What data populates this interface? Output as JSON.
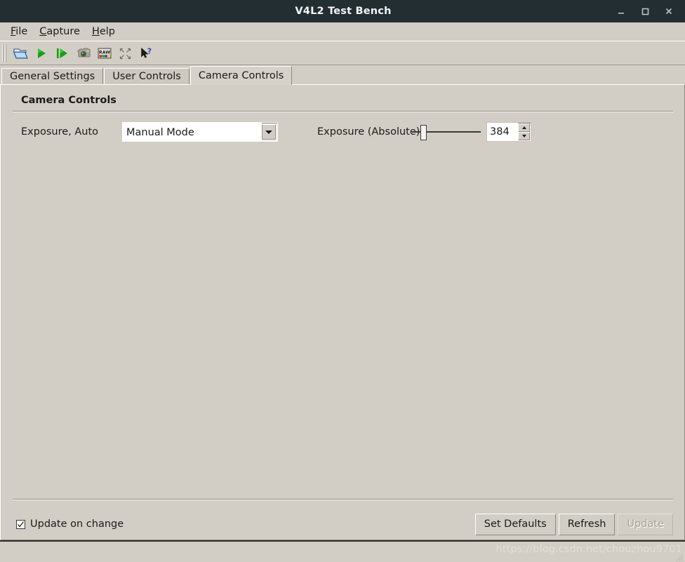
{
  "window": {
    "title": "V4L2 Test Bench",
    "buttons": [
      {
        "name": "minimize-button",
        "icon": "minimize-icon",
        "label": "_"
      },
      {
        "name": "maximize-button",
        "icon": "maximize-icon",
        "label": "□"
      },
      {
        "name": "close-button",
        "icon": "close-icon",
        "label": "×"
      }
    ]
  },
  "menubar": {
    "items": [
      {
        "mnemonic": "F",
        "rest": "ile",
        "name": "menu-file"
      },
      {
        "mnemonic": "C",
        "rest": "apture",
        "name": "menu-capture"
      },
      {
        "mnemonic": "H",
        "rest": "elp",
        "name": "menu-help"
      }
    ]
  },
  "toolbar": {
    "buttons": [
      {
        "icon": "open-folder-icon",
        "name": "toolbar-open"
      },
      {
        "icon": "play-icon",
        "name": "toolbar-play"
      },
      {
        "icon": "play-step-icon",
        "name": "toolbar-step"
      },
      {
        "icon": "camera-icon",
        "name": "toolbar-snapshot"
      },
      {
        "icon": "raw-icon",
        "name": "toolbar-raw"
      },
      {
        "icon": "fullscreen-icon",
        "name": "toolbar-fullscreen"
      },
      {
        "icon": "whats-this-icon",
        "name": "toolbar-whats-this"
      }
    ]
  },
  "tabs": [
    {
      "label": "General Settings",
      "selected": false,
      "name": "tab-general-settings"
    },
    {
      "label": "User Controls",
      "selected": false,
      "name": "tab-user-controls"
    },
    {
      "label": "Camera Controls",
      "selected": true,
      "name": "tab-camera-controls"
    }
  ],
  "panel": {
    "group_title": "Camera Controls",
    "controls": [
      {
        "label": "Exposure, Auto",
        "type": "combobox",
        "value": "Manual Mode",
        "name": "exposure-auto"
      },
      {
        "label": "Exposure (Absolute)",
        "type": "slider-spin",
        "value": "384",
        "slider_percent": 12,
        "name": "exposure-absolute"
      }
    ]
  },
  "bottom": {
    "checkbox": {
      "label": "Update on change",
      "checked": true
    },
    "buttons": [
      {
        "label": "Set Defaults",
        "disabled": false,
        "name": "set-defaults-button"
      },
      {
        "label": "Refresh",
        "disabled": false,
        "name": "refresh-button"
      },
      {
        "label": "Update",
        "disabled": true,
        "name": "update-button"
      }
    ]
  },
  "status": {
    "watermark": "https://blog.csdn.net/chouzhou9701"
  },
  "colors": {
    "titlebar": "#232e33",
    "window_bg": "#d2cec6",
    "field_bg": "#ffffff",
    "text": "#1b1b1b",
    "disabled_text": "#a6a29a",
    "play_green": "#12a012"
  }
}
